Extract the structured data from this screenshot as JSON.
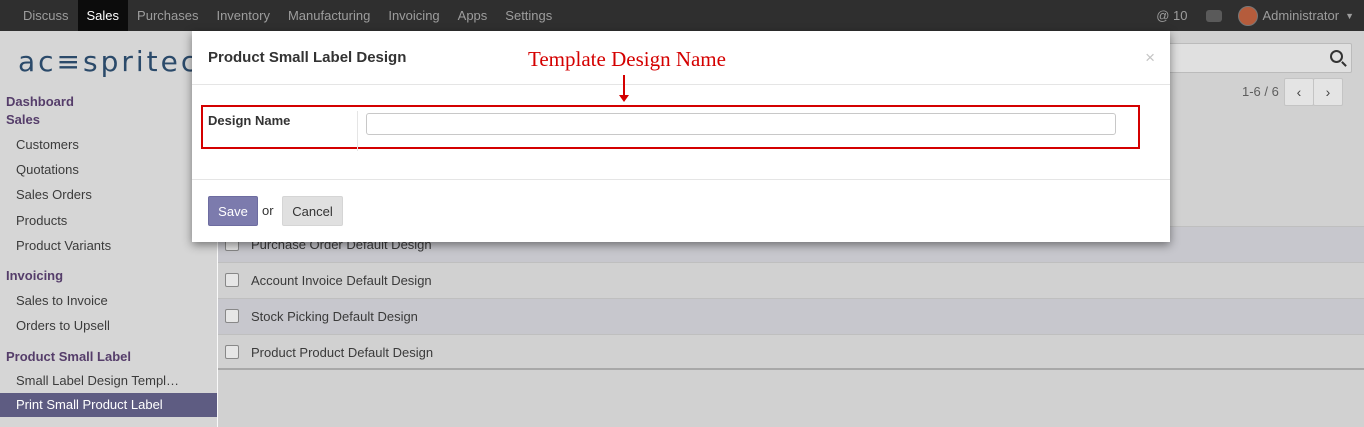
{
  "navbar": {
    "menu": [
      "Discuss",
      "Sales",
      "Purchases",
      "Inventory",
      "Manufacturing",
      "Invoicing",
      "Apps",
      "Settings"
    ],
    "active": "Sales",
    "messages_count": "10",
    "user": "Administrator"
  },
  "sidebar": {
    "logo": "ac≡spritech",
    "sections": [
      {
        "title": "Dashboard"
      },
      {
        "title": "Sales",
        "items": [
          "Customers",
          "Quotations",
          "Sales Orders",
          "Products",
          "Product Variants"
        ]
      },
      {
        "title": "Invoicing",
        "items": [
          "Sales to Invoice",
          "Orders to Upsell"
        ]
      },
      {
        "title": "Product Small Label",
        "items": [
          "Small Label Design Templ…",
          "Print Small Product Label"
        ]
      }
    ]
  },
  "main": {
    "pager": "1-6 / 6",
    "rows": [
      "Purchase Order Default Design",
      "Account Invoice Default Design",
      "Stock Picking Default Design",
      "Product Product Default Design"
    ]
  },
  "modal": {
    "title": "Product Small Label Design",
    "close_symbol": "×",
    "annotation": "Template Design Name",
    "field_label": "Design Name",
    "field_value": "",
    "save_label": "Save",
    "or_text": "or",
    "cancel_label": "Cancel"
  },
  "colors": {
    "navbar": "#2f2f2f",
    "accent": "#7c7bad",
    "annotation": "#d40000"
  }
}
